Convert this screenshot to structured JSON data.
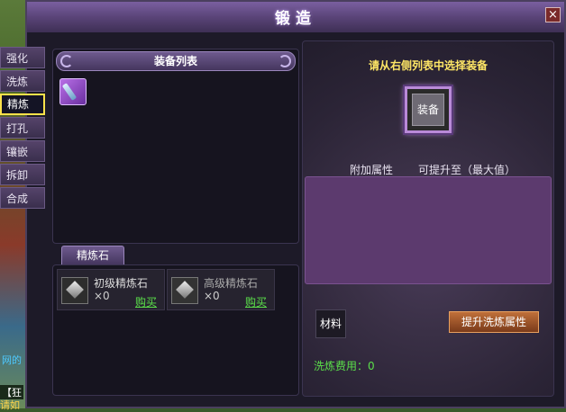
{
  "window": {
    "title": "锻造",
    "close_label": "×"
  },
  "tabs": [
    "强化",
    "洗炼",
    "精炼",
    "打孔",
    "镶嵌",
    "拆卸",
    "合成"
  ],
  "active_tab": "精炼",
  "equip_list": {
    "header": "装备列表",
    "items": [
      {
        "icon": "spear-item-icon"
      }
    ]
  },
  "stone_tab": "精炼石",
  "stones": [
    {
      "name": "初级精炼石",
      "count": "×0",
      "buy": "购买"
    },
    {
      "name": "高级精炼石",
      "count": "×0",
      "buy": "购买"
    }
  ],
  "right": {
    "instruction": "请从右侧列表中选择装备",
    "equip_slot": "装备",
    "attr_col1": "附加属性",
    "attr_col2": "可提升至（最大值）",
    "material_label": "材料",
    "upgrade_label": "提升洗炼属性",
    "cost_label": "洗炼费用：0"
  },
  "background": {
    "text1": "网的",
    "text2": "【狂",
    "text3": "请如"
  },
  "colors": {
    "accent_gold": "#ffe766",
    "green": "#5be04a",
    "purple": "#5c3a6e",
    "active_border": "#ffe24a"
  }
}
